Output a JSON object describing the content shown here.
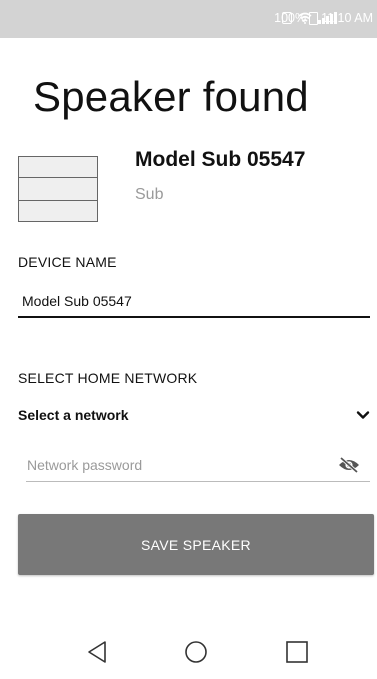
{
  "status_bar": {
    "battery": "100%",
    "time": "11:10 AM",
    "icons": [
      "vibrate-icon",
      "wifi-icon",
      "signal-icon",
      "battery-icon"
    ]
  },
  "page": {
    "title": "Speaker found"
  },
  "device": {
    "name": "Model Sub 05547",
    "type": "Sub"
  },
  "device_name_section": {
    "label": "DEVICE NAME",
    "value": "Model Sub 05547"
  },
  "network_section": {
    "label": "SELECT HOME NETWORK",
    "select_value": "Select a network",
    "password_placeholder": "Network password"
  },
  "actions": {
    "save_label": "SAVE SPEAKER"
  },
  "nav_bar": {
    "icons": [
      "back-icon",
      "home-icon",
      "recents-icon"
    ]
  },
  "colors": {
    "status_bar": "#d3d3d3",
    "button": "#787878",
    "secondary_text": "#9a9a9a"
  }
}
